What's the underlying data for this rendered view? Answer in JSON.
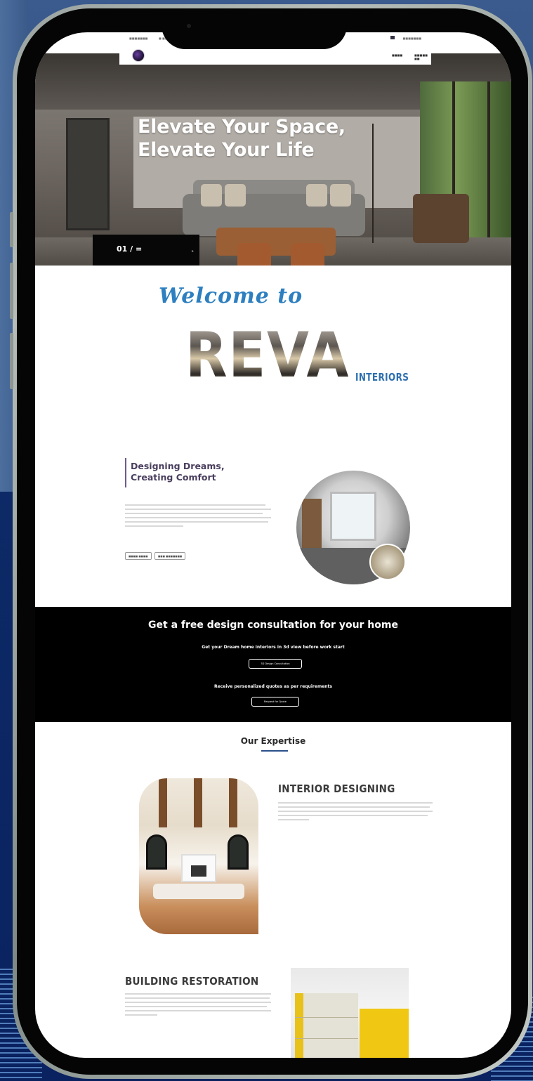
{
  "topbar": {
    "left_text": "■■■■■■■",
    "left_text2": "■ ■■■",
    "right_text": "■■■■■■■"
  },
  "nav": {
    "contact": "■■■■",
    "about": "■■■■■ ■■"
  },
  "hero": {
    "title_line1": "Elevate Your Space,",
    "title_line2": "Elevate Your Life",
    "slide_counter": "01 / ="
  },
  "welcome": {
    "script_text": "Welcome to",
    "brand": "REVA",
    "brand_sub": "INTERIORS"
  },
  "about": {
    "title_line1": "Designing Dreams,",
    "title_line2": "Creating Comfort",
    "button1": "■■■■ ■■■■",
    "button2": "■■■ ■■■■■■■"
  },
  "consultation": {
    "title": "Get a free design consultation for your home",
    "line1": "Get your Dream home interiors in 3d view before work start",
    "button1": "3D Design Consultation",
    "line2": "Receive personalized quotes as per requirements",
    "button2": "Request for Quote"
  },
  "expertise": {
    "title": "Our Expertise",
    "interior_heading": "INTERIOR DESIGNING",
    "restoration_heading": "BUILDING RESTORATION"
  },
  "colors": {
    "accent_blue": "#2d7fc0",
    "dark": "#000000",
    "phone_frame": "#9aa3a0"
  }
}
